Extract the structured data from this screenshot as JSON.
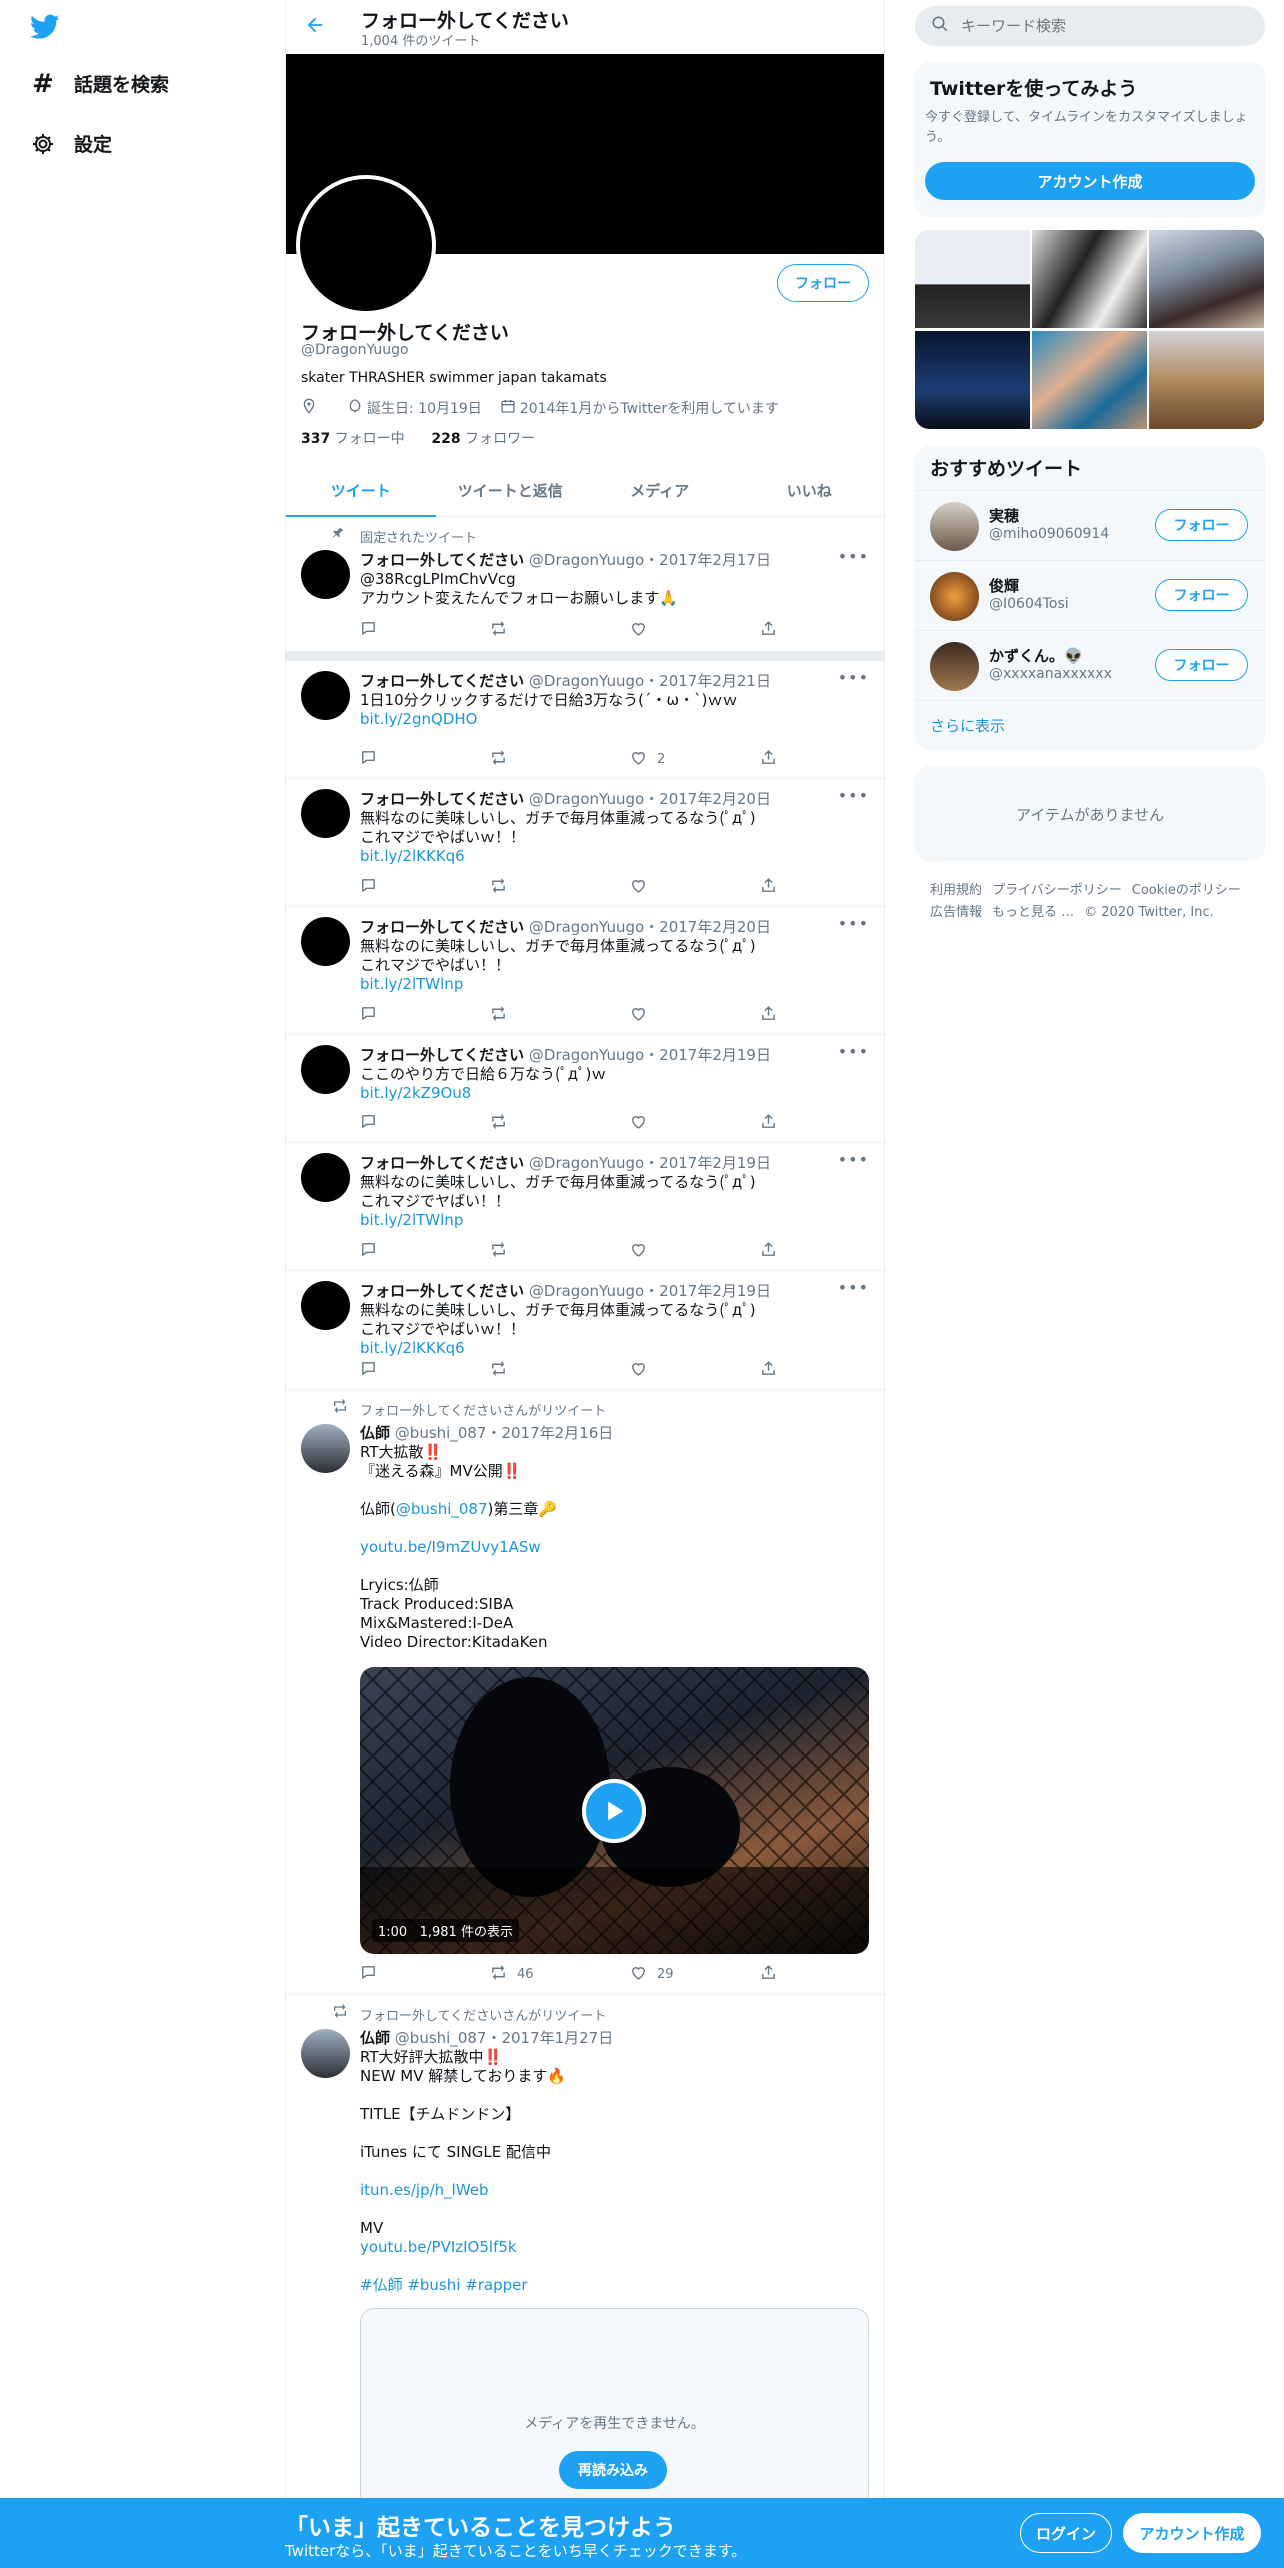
{
  "nav": {
    "explore": "話題を検索",
    "settings": "設定"
  },
  "header": {
    "title": "フォロー外してください",
    "tweet_count": "1,004 件のツイート"
  },
  "profile": {
    "name": "フォロー外してください",
    "handle": "@DragonYuugo",
    "bio": "skater THRASHER swimmer japan takamats",
    "birthday": "誕生日: 10月19日",
    "joined": "2014年1月からTwitterを利用しています",
    "following_count": "337",
    "following_label": "フォロー中",
    "followers_count": "228",
    "followers_label": "フォロワー",
    "follow_button": "フォロー"
  },
  "tabs": [
    "ツイート",
    "ツイートと返信",
    "メディア",
    "いいね"
  ],
  "tweets": [
    {
      "context": "固定されたツイート",
      "name": "フォロー外してください",
      "handle": "@DragonYuugo",
      "date": "・2017年2月17日",
      "text": "@38RcgLPImChvVcg\nアカウント変えたんでフォローお願いします🙏",
      "link": "",
      "reply": "",
      "retweet": "",
      "like": ""
    },
    {
      "context": "",
      "name": "フォロー外してください",
      "handle": "@DragonYuugo",
      "date": "・2017年2月21日",
      "text": "1日10分クリックするだけで日給3万なう(´・ω・`)ｗｗ",
      "link": "bit.ly/2gnQDHO",
      "reply": "",
      "retweet": "",
      "like": "2"
    },
    {
      "context": "",
      "name": "フォロー外してください",
      "handle": "@DragonYuugo",
      "date": "・2017年2月20日",
      "text": "無料なのに美味しいし、ガチで毎月体重減ってるなう(ﾟдﾟ)\nこれマジでやばいｗ！！",
      "link": "bit.ly/2lKKKq6",
      "reply": "",
      "retweet": "",
      "like": ""
    },
    {
      "context": "",
      "name": "フォロー外してください",
      "handle": "@DragonYuugo",
      "date": "・2017年2月20日",
      "text": "無料なのに美味しいし、ガチで毎月体重減ってるなう(ﾟдﾟ)\nこれマジでやばい！！",
      "link": "bit.ly/2lTWlnp",
      "reply": "",
      "retweet": "",
      "like": ""
    },
    {
      "context": "",
      "name": "フォロー外してください",
      "handle": "@DragonYuugo",
      "date": "・2017年2月19日",
      "text": "ここのやり方で日給６万なう(ﾟдﾟ)ｗ",
      "link": "bit.ly/2kZ9Ou8",
      "reply": "",
      "retweet": "",
      "like": ""
    },
    {
      "context": "",
      "name": "フォロー外してください",
      "handle": "@DragonYuugo",
      "date": "・2017年2月19日",
      "text": "無料なのに美味しいし、ガチで毎月体重減ってるなう(ﾟдﾟ)\nこれマジでヤばい！！",
      "link": "bit.ly/2lTWlnp",
      "reply": "",
      "retweet": "",
      "like": ""
    },
    {
      "context": "",
      "name": "フォロー外してください",
      "handle": "@DragonYuugo",
      "date": "・2017年2月19日",
      "text": "無料なのに美味しいし、ガチで毎月体重減ってるなう(ﾟдﾟ)\nこれマジでやばいｗ！！",
      "link": "bit.ly/2lKKKq6",
      "reply": "",
      "retweet": "",
      "like": ""
    }
  ],
  "rt1": {
    "context": "フォロー外してくださいさんがリツイート",
    "name": "仏師",
    "handle": "@bushi_087",
    "date": "・2017年2月16日",
    "line1": "RT大拡散‼️",
    "line2": "『迷える森』MV公開‼️",
    "line3_pre": "仏師(",
    "line3_mention": "@bushi_087",
    "line3_post": ")第三章🔑",
    "link": "youtu.be/I9mZUvy1ASw",
    "credits": "Lryics:仏師\nTrack Produced:SIBA\nMix&Mastered:I-DeA\nVideo Director:KitadaKen",
    "video_time": "1:00",
    "video_views": "1,981 件の表示",
    "retweet": "46",
    "like": "29"
  },
  "rt2": {
    "context": "フォロー外してくださいさんがリツイート",
    "name": "仏師",
    "handle": "@bushi_087",
    "date": "・2017年1月27日",
    "line1": "RT大好評大拡散中‼️",
    "line2": "NEW MV 解禁しております🔥",
    "line3": "TITLE【チムドンドン】",
    "line4": "iTunes にて SINGLE 配信中",
    "link1": "itun.es/jp/h_lWeb",
    "line5": "MV",
    "link2": "youtu.be/PVIzIO5lf5k",
    "tags": "#仏師 #bushi #rapper",
    "media_msg": "メディアを再生できません。",
    "reload": "再読み込み"
  },
  "right": {
    "search_placeholder": "キーワード検索",
    "signup_title": "Twitterを使ってみよう",
    "signup_text": "今すぐ登録して、タイムラインをカスタマイズしましょう。",
    "signup_button": "アカウント作成",
    "rec_title": "おすすめツイート",
    "recs": [
      {
        "name": "実穂",
        "handle": "@miho09060914",
        "button": "フォロー"
      },
      {
        "name": "俊輝",
        "handle": "@I0604Tosi",
        "button": "フォロー"
      },
      {
        "name": "かずくん。👽",
        "handle": "@xxxxanaxxxxxx",
        "button": "フォロー"
      }
    ],
    "show_more": "さらに表示",
    "no_items": "アイテムがありません",
    "footer": [
      "利用規約",
      "プライバシーポリシー",
      "Cookieのポリシー",
      "広告情報",
      "もっと見る …",
      "© 2020 Twitter, Inc."
    ]
  },
  "bottombar": {
    "title": "「いま」起きていることを見つけよう",
    "subtitle": "Twitterなら、「いま」起きていることをいち早くチェックできます。",
    "login": "ログイン",
    "signup": "アカウント作成"
  },
  "colors": {
    "accent": "#1da1f2",
    "link": "#1b95e0",
    "muted": "#657786",
    "panel": "#f5f8fa"
  }
}
